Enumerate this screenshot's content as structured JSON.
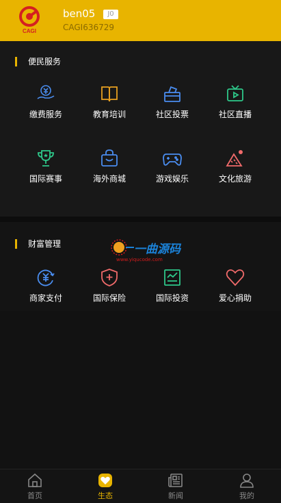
{
  "user": {
    "name": "ben05",
    "level": "J0",
    "id": "CAGI636729",
    "logo_text": "CAGI"
  },
  "sections": [
    {
      "title": "便民服务",
      "items": [
        {
          "label": "缴费服务",
          "icon": "payment-hand-icon",
          "color": "#4a8df0"
        },
        {
          "label": "教育培训",
          "icon": "book-icon",
          "color": "#e8a020"
        },
        {
          "label": "社区投票",
          "icon": "ballot-box-icon",
          "color": "#4a8df0"
        },
        {
          "label": "社区直播",
          "icon": "tv-live-icon",
          "color": "#2ec88a"
        },
        {
          "label": "国际赛事",
          "icon": "trophy-icon",
          "color": "#2ec88a"
        },
        {
          "label": "海外商城",
          "icon": "shopping-bag-icon",
          "color": "#4a8df0"
        },
        {
          "label": "游戏娱乐",
          "icon": "gamepad-icon",
          "color": "#4a8df0"
        },
        {
          "label": "文化旅游",
          "icon": "mountain-icon",
          "color": "#f06a6a"
        }
      ]
    },
    {
      "title": "财富管理",
      "items": [
        {
          "label": "商家支付",
          "icon": "yuan-refresh-icon",
          "color": "#4a8df0"
        },
        {
          "label": "国际保险",
          "icon": "shield-plus-icon",
          "color": "#f06a6a"
        },
        {
          "label": "国际投资",
          "icon": "chart-screen-icon",
          "color": "#2ec88a"
        },
        {
          "label": "爱心捐助",
          "icon": "heart-icon",
          "color": "#f06a6a"
        }
      ]
    }
  ],
  "watermark": {
    "text": "一曲源码",
    "url": "www.yiqucode.com"
  },
  "tabs": [
    {
      "label": "首页",
      "icon": "home-icon",
      "active": false
    },
    {
      "label": "生态",
      "icon": "heart-badge-icon",
      "active": true
    },
    {
      "label": "新闻",
      "icon": "news-icon",
      "active": false
    },
    {
      "label": "我的",
      "icon": "user-icon",
      "active": false
    }
  ],
  "colors": {
    "accent": "#e8b400",
    "background": "#121212",
    "inactive_tab": "#888888"
  }
}
